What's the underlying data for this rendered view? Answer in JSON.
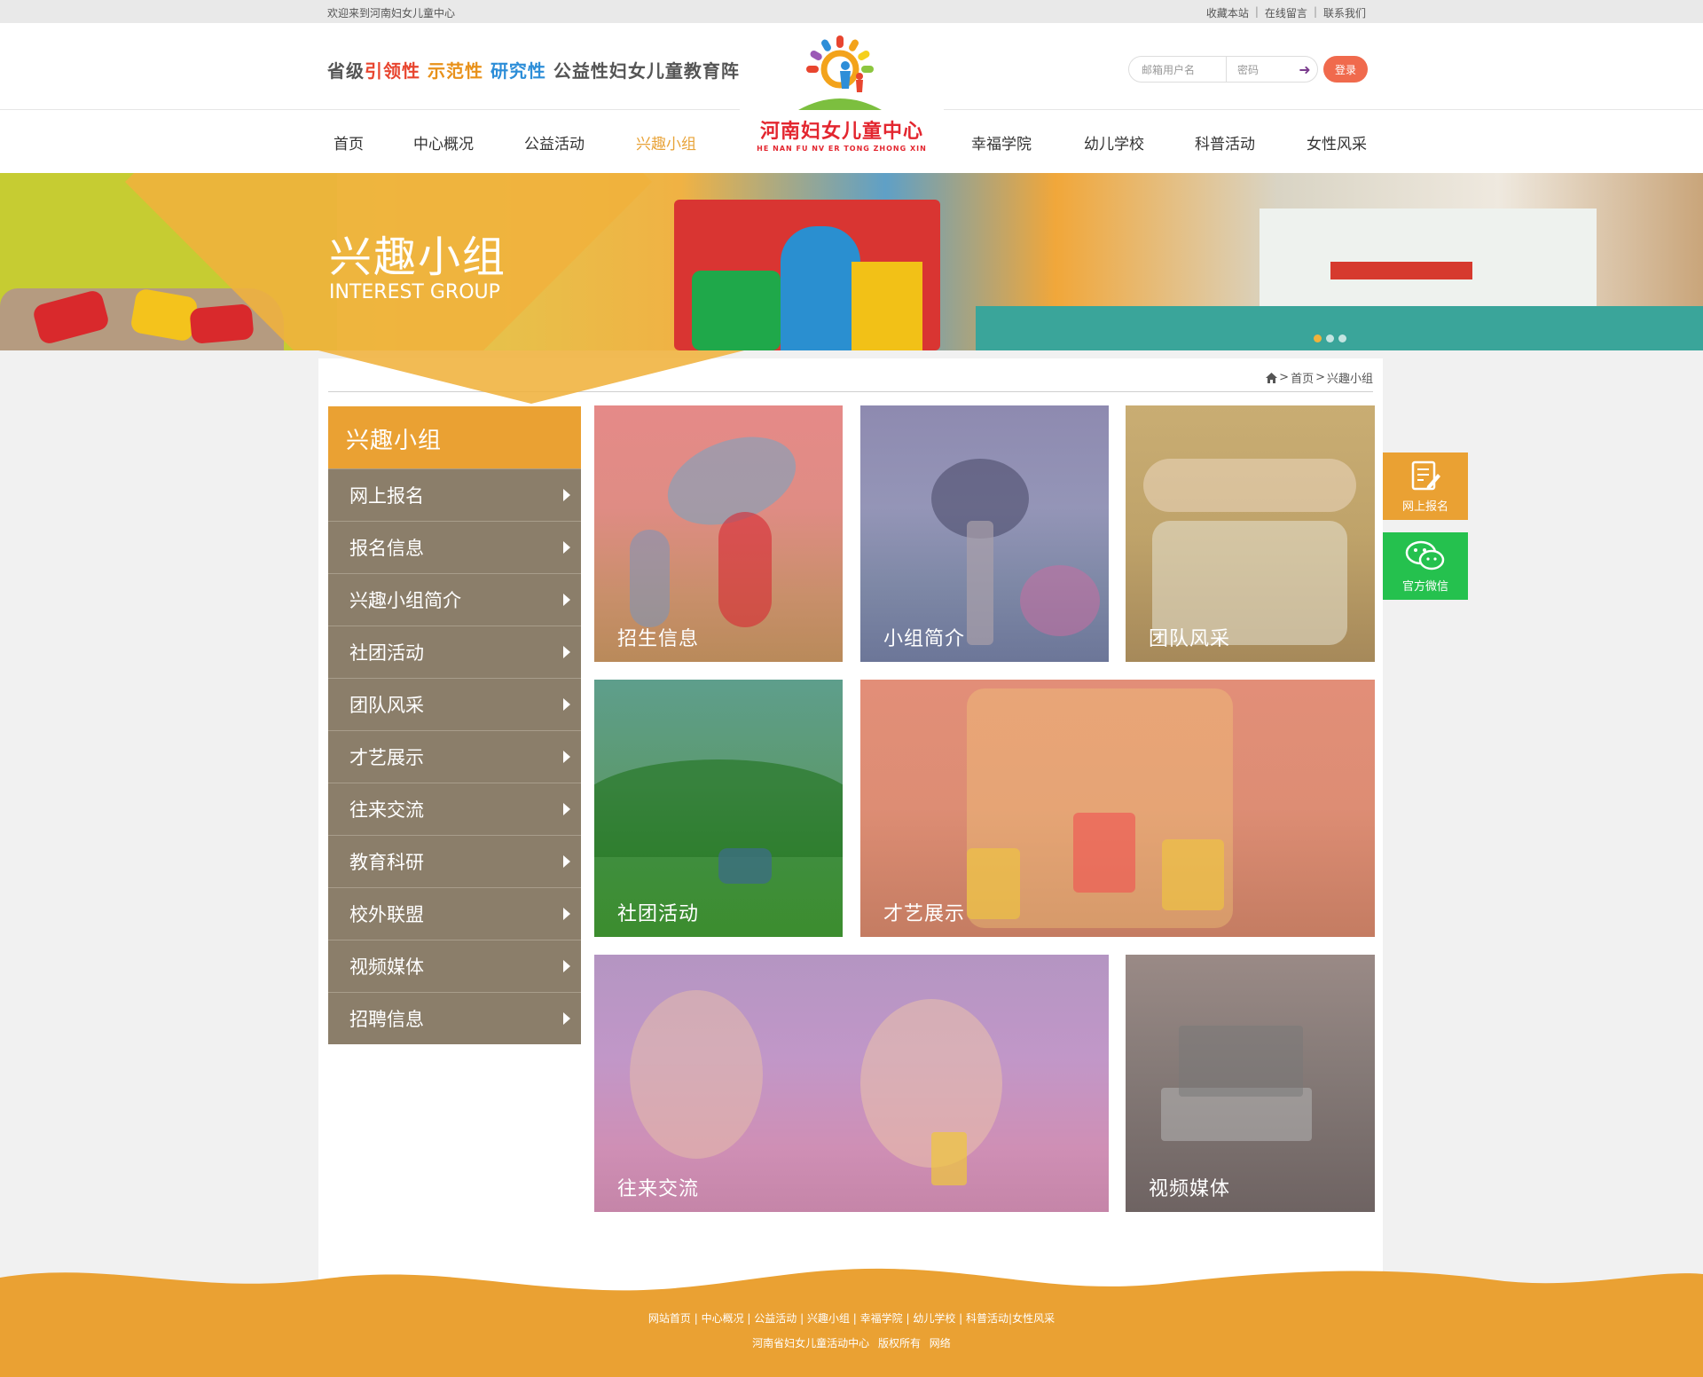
{
  "topbar": {
    "welcome": "欢迎来到河南妇女儿童中心",
    "links": [
      "收藏本站",
      "在线留言",
      "联系我们"
    ],
    "separator": "|"
  },
  "slogan": {
    "p1": "省级",
    "p2": "引领性",
    "p3": "示范性",
    "p4": "研究性",
    "p5": "公益性妇女儿童教育阵地"
  },
  "login": {
    "user_placeholder": "邮箱用户名",
    "pass_placeholder": "密码",
    "submit_label": "登录"
  },
  "logo": {
    "cn": "河南妇女儿童中心",
    "en": "HE NAN FU NV ER TONG  ZHONG XIN"
  },
  "nav": {
    "items": [
      "首页",
      "中心概况",
      "公益活动",
      "兴趣小组",
      "幸福学院",
      "幼儿学校",
      "科普活动",
      "女性风采"
    ],
    "active": "兴趣小组"
  },
  "banner": {
    "title": "兴趣小组",
    "subtitle": "INTEREST GROUP"
  },
  "breadcrumb": {
    "home": "首页",
    "sep": ">",
    "current": "兴趣小组"
  },
  "sidebar": {
    "title": "兴趣小组",
    "items": [
      "网上报名",
      "报名信息",
      "兴趣小组简介",
      "社团活动",
      "团队风采",
      "才艺展示",
      "往来交流",
      "教育科研",
      "校外联盟",
      "视频媒体",
      "招聘信息"
    ]
  },
  "tiles": [
    "招生信息",
    "小组简介",
    "团队风采",
    "社团活动",
    "才艺展示",
    "往来交流",
    "视频媒体"
  ],
  "float": {
    "signup": "网上报名",
    "wechat": "官方微信"
  },
  "footer": {
    "links": [
      "网站首页",
      "中心概况",
      "公益活动",
      "兴趣小组",
      "幸福学院",
      "幼儿学校",
      "科普活动",
      "女性风采"
    ],
    "copyright": "河南省妇女儿童活动中心  版权所有  网络"
  },
  "colors": {
    "accent": "#eaa133",
    "sidebar": "#8b7e6a",
    "wechat": "#25c14e",
    "logo_red": "#e3262f"
  }
}
